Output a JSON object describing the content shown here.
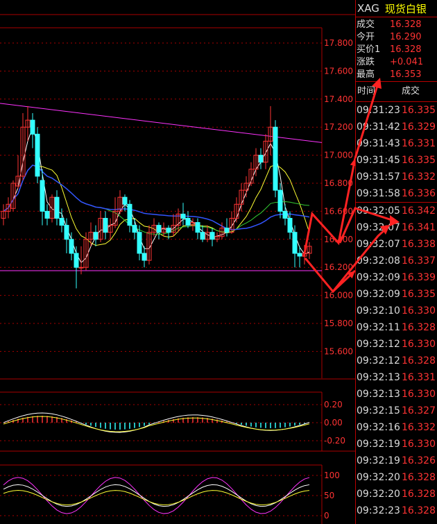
{
  "chart": {
    "price_axis": [
      "17.800",
      "17.600",
      "17.400",
      "17.200",
      "17.000",
      "16.800",
      "16.600",
      "16.400",
      "16.200",
      "16.000",
      "15.800",
      "15.600"
    ],
    "macd_axis": [
      "0.20",
      "0.00",
      "-0.20"
    ],
    "kdj_axis": [
      "100",
      "50",
      "0"
    ],
    "colors": {
      "up": "#ff3333",
      "down": "#33ffff",
      "grid": "#aa0000",
      "axis_text": "#ff3333",
      "line_magenta": "#ff33ff",
      "line_white": "#ffffff",
      "line_yellow": "#ffff33",
      "line_blue": "#3355ff",
      "line_green": "#33cc33",
      "arrow": "#ff2222"
    }
  },
  "panel": {
    "symbol": "XAG",
    "name": "现货白银",
    "quote": [
      {
        "label": "成交",
        "value": "16.328"
      },
      {
        "label": "今开",
        "value": "16.290"
      },
      {
        "label": "买价1",
        "value": "16.328"
      },
      {
        "label": "涨跌",
        "value": "+0.041"
      },
      {
        "label": "最高",
        "value": "16.353"
      }
    ],
    "time_header": "时间",
    "price_header": "成交",
    "trades": [
      {
        "time": "09:31:23",
        "price": "16.335"
      },
      {
        "time": "09:31:42",
        "price": "16.329"
      },
      {
        "time": "09:31:43",
        "price": "16.331"
      },
      {
        "time": "09:31:45",
        "price": "16.335"
      },
      {
        "time": "09:31:57",
        "price": "16.332"
      },
      {
        "time": "09:31:58",
        "price": "16.336"
      },
      {
        "time": "09:32:05",
        "price": "16.342"
      },
      {
        "time": "09:32:07",
        "price": "16.341"
      },
      {
        "time": "09:32:07",
        "price": "16.338"
      },
      {
        "time": "09:32:08",
        "price": "16.337"
      },
      {
        "time": "09:32:09",
        "price": "16.339"
      },
      {
        "time": "09:32:09",
        "price": "16.335"
      },
      {
        "time": "09:32:10",
        "price": "16.330"
      },
      {
        "time": "09:32:11",
        "price": "16.328"
      },
      {
        "time": "09:32:12",
        "price": "16.330"
      },
      {
        "time": "09:32:12",
        "price": "16.328"
      },
      {
        "time": "09:32:13",
        "price": "16.331"
      },
      {
        "time": "09:32:13",
        "price": "16.330"
      },
      {
        "time": "09:32:15",
        "price": "16.327"
      },
      {
        "time": "09:32:16",
        "price": "16.332"
      },
      {
        "time": "09:32:19",
        "price": "16.330"
      },
      {
        "time": "09:32:19",
        "price": "16.326"
      },
      {
        "time": "09:32:20",
        "price": "16.328"
      },
      {
        "time": "09:32:20",
        "price": "16.328"
      },
      {
        "time": "09:32:23",
        "price": "16.328"
      }
    ]
  }
}
